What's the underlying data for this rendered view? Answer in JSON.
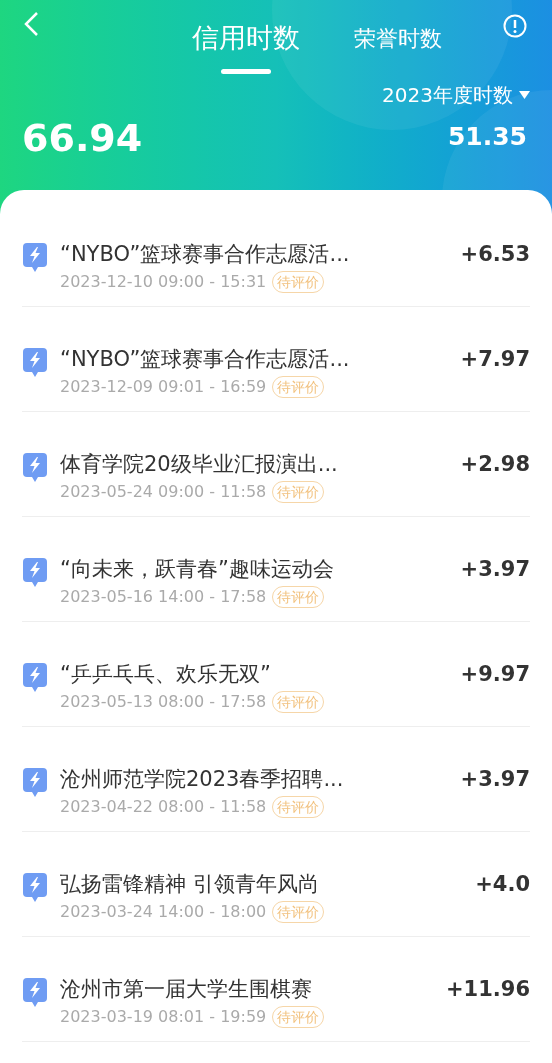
{
  "header": {
    "tabs": [
      {
        "label": "信用时数",
        "selected": true
      },
      {
        "label": "荣誉时数",
        "selected": false
      }
    ],
    "total": "66.94",
    "year_selector": "2023年度时数",
    "year_total": "51.35"
  },
  "records": [
    {
      "title": "“NYBO”篮球赛事合作志愿活...",
      "time": "2023-12-10 09:00 - 15:31",
      "status": "待评价",
      "hours": "+6.53"
    },
    {
      "title": "“NYBO”篮球赛事合作志愿活...",
      "time": "2023-12-09 09:01 - 16:59",
      "status": "待评价",
      "hours": "+7.97"
    },
    {
      "title": "体育学院20级毕业汇报演出...",
      "time": "2023-05-24 09:00 - 11:58",
      "status": "待评价",
      "hours": "+2.98"
    },
    {
      "title": "“向未来，跃青春”趣味运动会",
      "time": "2023-05-16 14:00 - 17:58",
      "status": "待评价",
      "hours": "+3.97"
    },
    {
      "title": "“乒乒乓乓、欢乐无双”",
      "time": "2023-05-13 08:00 - 17:58",
      "status": "待评价",
      "hours": "+9.97"
    },
    {
      "title": "沧州师范学院2023春季招聘...",
      "time": "2023-04-22 08:00 - 11:58",
      "status": "待评价",
      "hours": "+3.97"
    },
    {
      "title": "弘扬雷锋精神  引领青年风尚",
      "time": "2023-03-24 14:00 - 18:00",
      "status": "待评价",
      "hours": "+4.0"
    },
    {
      "title": "沧州市第一届大学生围棋赛",
      "time": "2023-03-19 08:01 - 19:59",
      "status": "待评价",
      "hours": "+11.96"
    }
  ]
}
